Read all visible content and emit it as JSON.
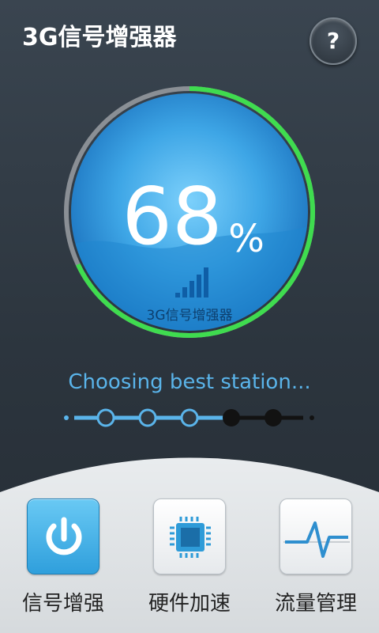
{
  "header": {
    "title": "3G信号增强器",
    "help_label": "?"
  },
  "gauge": {
    "percent_value": "68",
    "percent_sign": "%",
    "caption": "3G信号增强器",
    "level": 0.68
  },
  "status": {
    "text": "Choosing best station..."
  },
  "progress": {
    "steps_total": 5,
    "steps_done": 3
  },
  "features": [
    {
      "label": "信号增强",
      "icon": "power-icon",
      "active": true
    },
    {
      "label": "硬件加速",
      "icon": "chip-icon",
      "active": false
    },
    {
      "label": "流量管理",
      "icon": "pulse-icon",
      "active": false
    }
  ],
  "colors": {
    "accent": "#5ab4ea",
    "ring_active": "#3fdc4f",
    "ring_inactive": "#8a8f95",
    "dial_blue": "#3aa3e3"
  }
}
